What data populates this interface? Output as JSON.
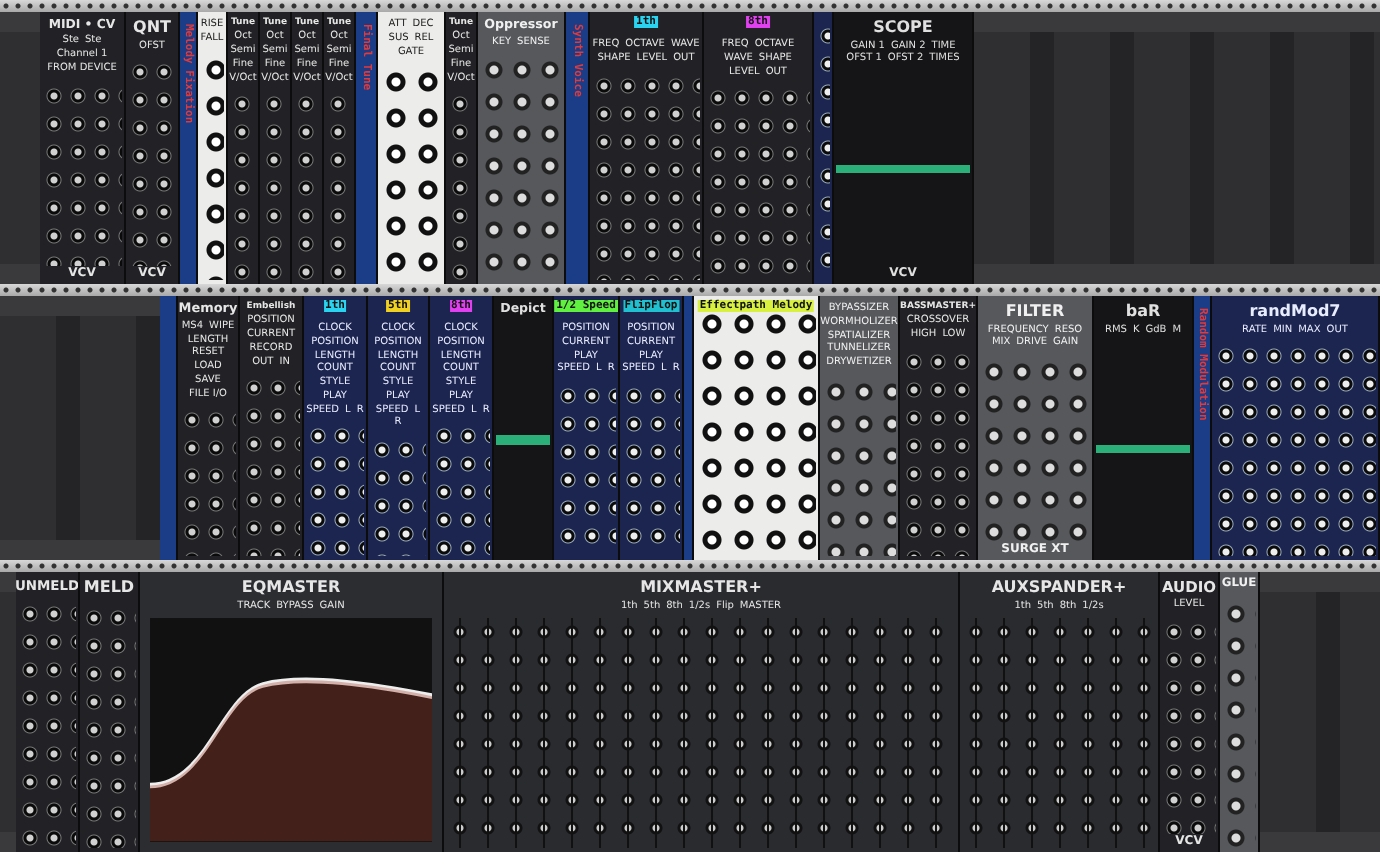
{
  "rack_rows": [
    {
      "modules": [
        {
          "kind": "blank"
        },
        {
          "kind": "dark",
          "title": "MIDI • CV",
          "labels": [
            "Ste",
            "Ste",
            "Channel 1",
            "FROM DEVICE"
          ],
          "footer": "VCV"
        },
        {
          "kind": "dark",
          "title": "QNT",
          "labels": [
            "OFST"
          ],
          "footer": "VCV"
        },
        {
          "kind": "strip",
          "title": "Melody Fixation"
        },
        {
          "kind": "white",
          "labels": [
            "RISE",
            "FALL"
          ]
        },
        {
          "kind": "dark",
          "title": "Tune",
          "labels": [
            "Oct",
            "Semi",
            "Fine",
            "V/Oct"
          ]
        },
        {
          "kind": "dark",
          "title": "Tune",
          "labels": [
            "Oct",
            "Semi",
            "Fine",
            "V/Oct"
          ]
        },
        {
          "kind": "dark",
          "title": "Tune",
          "labels": [
            "Oct",
            "Semi",
            "Fine",
            "V/Oct"
          ]
        },
        {
          "kind": "dark",
          "title": "Tune",
          "labels": [
            "Oct",
            "Semi",
            "Fine",
            "V/Oct"
          ]
        },
        {
          "kind": "strip",
          "title": "Final Tune"
        },
        {
          "kind": "white",
          "labels": [
            "ATT",
            "DEC",
            "SUS",
            "REL",
            "GATE"
          ]
        },
        {
          "kind": "dark",
          "title": "Tune",
          "labels": [
            "Oct",
            "Semi",
            "Fine",
            "V/Oct"
          ]
        },
        {
          "kind": "grey",
          "title": "Oppressor",
          "labels": [
            "KEY",
            "SENSE"
          ]
        },
        {
          "kind": "strip",
          "title": "Synth Voice"
        },
        {
          "kind": "dark",
          "tag": {
            "text": "1th",
            "color": "#2ad4f0"
          },
          "labels": [
            "FREQ",
            "OCTAVE",
            "WAVE",
            "SHAPE",
            "LEVEL",
            "OUT"
          ]
        },
        {
          "kind": "dark",
          "tag": {
            "text": "8th",
            "color": "#e040f0"
          },
          "labels": [
            "FREQ",
            "OCTAVE",
            "WAVE",
            "SHAPE",
            "LEVEL",
            "OUT"
          ]
        },
        {
          "kind": "navy"
        },
        {
          "kind": "screen",
          "title": "SCOPE",
          "labels": [
            "GAIN 1",
            "GAIN 2",
            "TIME",
            "OFST 1",
            "OFST 2",
            "TIMES"
          ],
          "footer": "VCV"
        },
        {
          "kind": "blank"
        }
      ]
    },
    {
      "modules": [
        {
          "kind": "blank"
        },
        {
          "kind": "strip"
        },
        {
          "kind": "dark",
          "title": "Memory",
          "labels": [
            "MS4",
            "WIPE",
            "LENGTH",
            "RESET",
            "LOAD",
            "SAVE",
            "FILE I/O"
          ]
        },
        {
          "kind": "dark",
          "title": "Embellish",
          "labels": [
            "POSITION",
            "CURRENT",
            "RECORD",
            "OUT",
            "IN"
          ]
        },
        {
          "kind": "navy",
          "tag": {
            "text": "1th",
            "color": "#2ad4f0"
          },
          "labels": [
            "CLOCK",
            "POSITION",
            "LENGTH",
            "COUNT",
            "STYLE",
            "PLAY",
            "SPEED",
            "L",
            "R"
          ]
        },
        {
          "kind": "navy",
          "tag": {
            "text": "5th",
            "color": "#f0d020"
          },
          "labels": [
            "CLOCK",
            "POSITION",
            "LENGTH",
            "COUNT",
            "STYLE",
            "PLAY",
            "SPEED",
            "L",
            "R"
          ]
        },
        {
          "kind": "navy",
          "tag": {
            "text": "8th",
            "color": "#e040f0"
          },
          "labels": [
            "CLOCK",
            "POSITION",
            "LENGTH",
            "COUNT",
            "STYLE",
            "PLAY",
            "SPEED",
            "L",
            "R"
          ]
        },
        {
          "kind": "screen",
          "title": "Depict"
        },
        {
          "kind": "navy",
          "tag": {
            "text": "1/2 Speed",
            "color": "#60f040"
          },
          "labels": [
            "POSITION",
            "CURRENT",
            "PLAY",
            "SPEED",
            "L",
            "R"
          ]
        },
        {
          "kind": "navy",
          "tag": {
            "text": "FlipFlop",
            "color": "#20c0d0"
          },
          "labels": [
            "POSITION",
            "CURRENT",
            "PLAY",
            "SPEED",
            "L",
            "R"
          ]
        },
        {
          "kind": "strip"
        },
        {
          "kind": "white",
          "tag": {
            "text": "Effectpath Melody",
            "color": "#d8f040"
          }
        },
        {
          "kind": "grey",
          "labels": [
            "BYPASSIZER",
            "WORMHOLIZER",
            "SPATIALIZER",
            "TUNNELIZER",
            "DRYWETIZER"
          ]
        },
        {
          "kind": "dark",
          "title": "BASSMASTER+",
          "labels": [
            "CROSSOVER",
            "HIGH",
            "LOW"
          ]
        },
        {
          "kind": "grey",
          "title": "FILTER",
          "labels": [
            "FREQUENCY",
            "RESO",
            "MIX",
            "DRIVE",
            "GAIN"
          ],
          "footer": "SURGE XT"
        },
        {
          "kind": "screen",
          "title": "baR",
          "labels": [
            "RMS",
            "K",
            "GdB",
            "M"
          ]
        },
        {
          "kind": "strip",
          "title": "Random Modulation"
        },
        {
          "kind": "navy",
          "title": "randMod7",
          "labels": [
            "RATE",
            "MIN",
            "MAX",
            "OUT"
          ]
        }
      ]
    },
    {
      "modules": [
        {
          "kind": "blank"
        },
        {
          "kind": "dark",
          "title": "UNMELD"
        },
        {
          "kind": "dark",
          "title": "MELD"
        },
        {
          "kind": "eq",
          "title": "EQMASTER",
          "labels": [
            "TRACK",
            "BYPASS",
            "GAIN"
          ]
        },
        {
          "kind": "mixer",
          "title": "MIXMASTER+",
          "labels": [
            "1th",
            "5th",
            "8th",
            "1/2s",
            "Flip",
            "MASTER"
          ]
        },
        {
          "kind": "mixer",
          "title": "AUXSPANDER+",
          "labels": [
            "1th",
            "5th",
            "8th",
            "1/2s"
          ]
        },
        {
          "kind": "dark",
          "title": "AUDIO",
          "labels": [
            "LEVEL"
          ],
          "footer": "VCV"
        },
        {
          "kind": "grey",
          "title": "GLUE"
        },
        {
          "kind": "blank"
        }
      ]
    }
  ]
}
